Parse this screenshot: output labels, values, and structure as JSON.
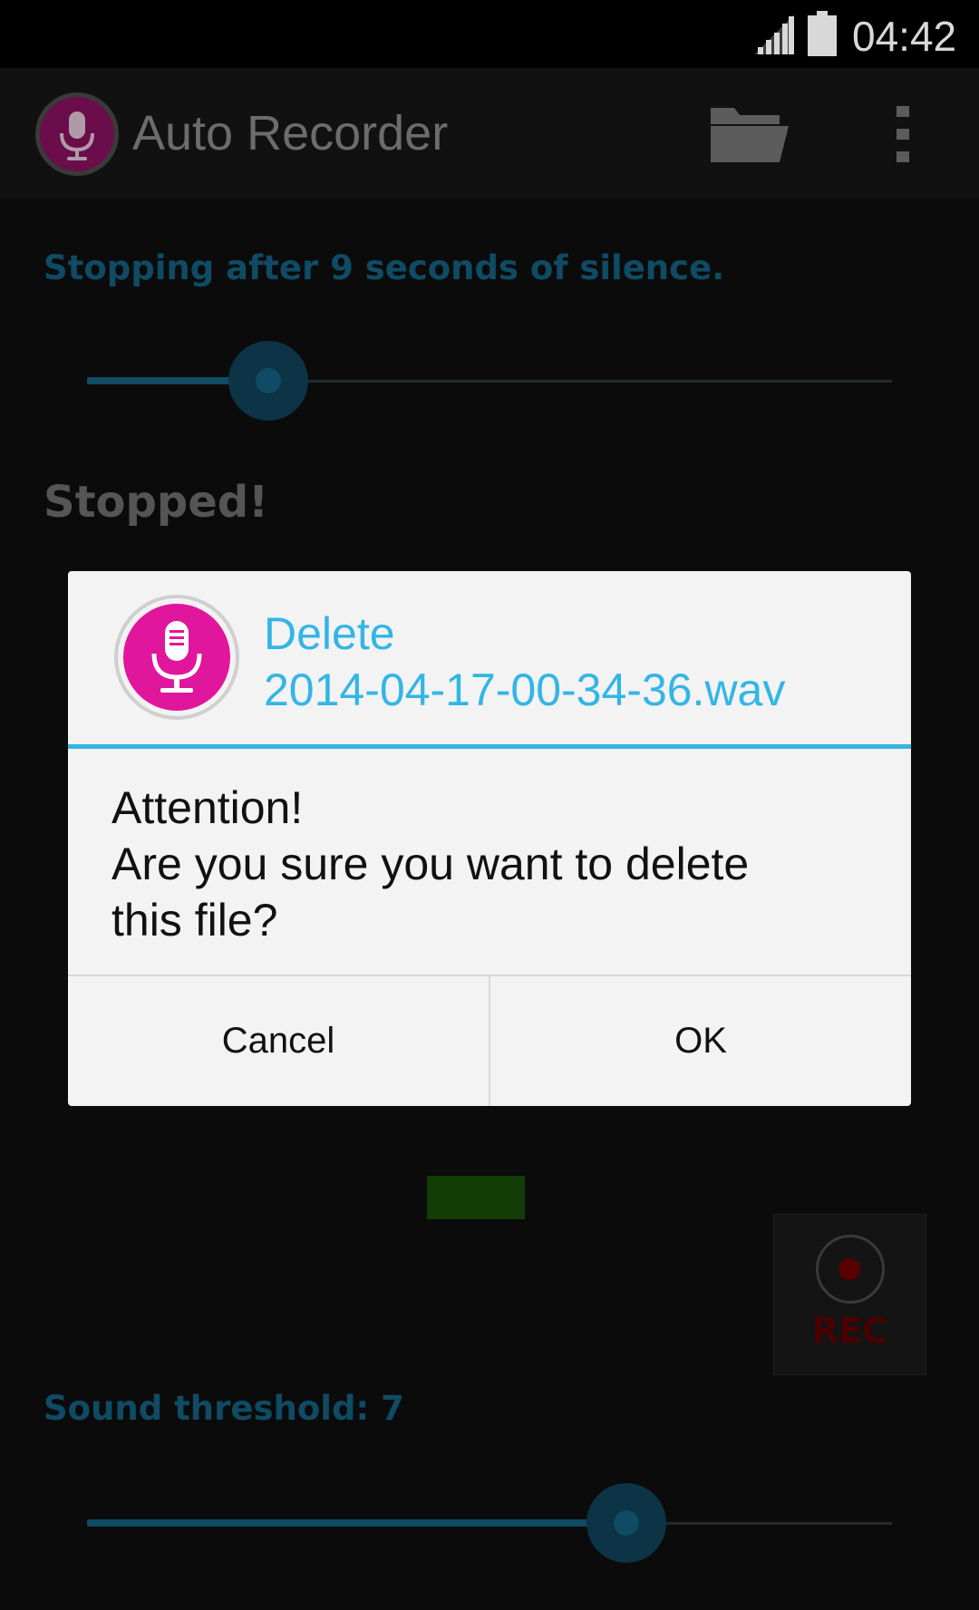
{
  "status_bar": {
    "time": "04:42",
    "icons": [
      "cell-signal-icon",
      "battery-icon"
    ]
  },
  "action_bar": {
    "title": "Auto Recorder",
    "icons": [
      "app-microphone-icon",
      "folder-icon",
      "overflow-menu-icon"
    ]
  },
  "main": {
    "silence_label": "Stopping after 9 seconds of silence.",
    "silence_slider_fraction": 0.225,
    "status": "Stopped!",
    "rec_button_label": "REC",
    "threshold_label": "Sound threshold: 7",
    "threshold_slider_fraction": 0.67
  },
  "dialog": {
    "title_line1": "Delete",
    "title_line2": "2014-04-17-00-34-36.wav",
    "message_line1": "Attention!",
    "message_line2": "Are you sure you want to delete",
    "message_line3": "this file?",
    "cancel_label": "Cancel",
    "ok_label": "OK"
  },
  "colors": {
    "accent": "#33b5e5",
    "icon_magenta": "#e0169c",
    "dim_accent": "#0f4b64",
    "meter_green": "#123d06",
    "rec_red": "#4a0000"
  }
}
